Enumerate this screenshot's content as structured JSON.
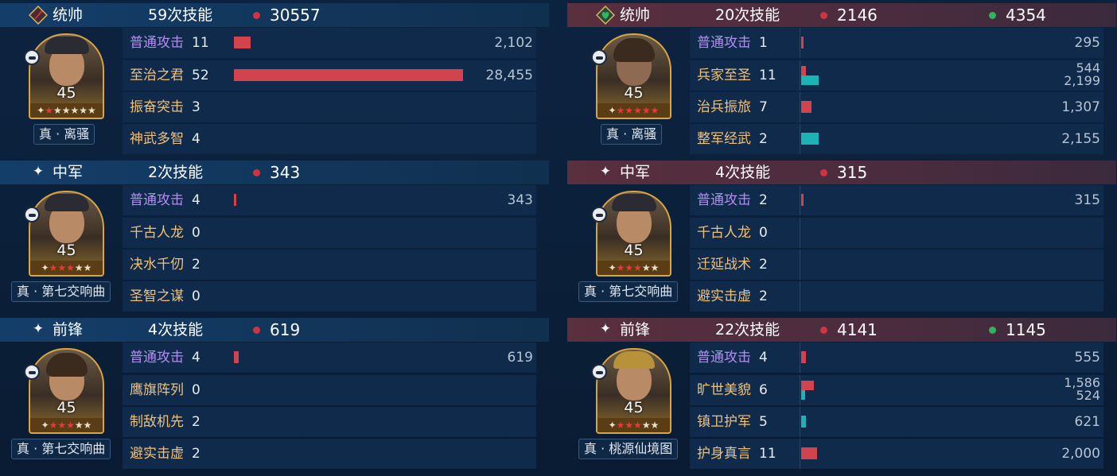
{
  "colors": {
    "damage_dot": "#d0343f",
    "heal_dot": "#2db560",
    "damage_bar": "#d2434e",
    "heal_bar": "#1bb3b3",
    "basic_attack_text": "#b58df2",
    "skill_text": "#f0c17a"
  },
  "left": {
    "generals": [
      {
        "role": "统帅",
        "role_icon": "red-diamond-sword-icon",
        "skill_count": "59次技能",
        "damage": "30557",
        "heal": "",
        "level": "45",
        "tactic": "真 · 离骚",
        "red_stars": 1,
        "total_stars": 6,
        "skills": [
          {
            "name": "普通攻击",
            "count": "11",
            "damage": 2102,
            "damage_text": "2,102",
            "heal": 0,
            "heal_text": "",
            "basic": true
          },
          {
            "name": "至治之君",
            "count": "52",
            "damage": 28455,
            "damage_text": "28,455",
            "heal": 0,
            "heal_text": "",
            "basic": false
          },
          {
            "name": "振奋突击",
            "count": "3",
            "damage": 0,
            "damage_text": "",
            "heal": 0,
            "heal_text": "",
            "basic": false
          },
          {
            "name": "神武多智",
            "count": "4",
            "damage": 0,
            "damage_text": "",
            "heal": 0,
            "heal_text": "",
            "basic": false
          }
        ]
      },
      {
        "role": "中军",
        "role_icon": "sparkle-icon",
        "skill_count": "2次技能",
        "damage": "343",
        "heal": "",
        "level": "45",
        "tactic": "真 · 第七交响曲",
        "red_stars": 3,
        "total_stars": 5,
        "skills": [
          {
            "name": "普通攻击",
            "count": "4",
            "damage": 343,
            "damage_text": "343",
            "heal": 0,
            "heal_text": "",
            "basic": true
          },
          {
            "name": "千古人龙",
            "count": "0",
            "damage": 0,
            "damage_text": "",
            "heal": 0,
            "heal_text": "",
            "basic": false
          },
          {
            "name": "决水千仞",
            "count": "2",
            "damage": 0,
            "damage_text": "",
            "heal": 0,
            "heal_text": "",
            "basic": false
          },
          {
            "name": "圣智之谋",
            "count": "0",
            "damage": 0,
            "damage_text": "",
            "heal": 0,
            "heal_text": "",
            "basic": false
          }
        ]
      },
      {
        "role": "前锋",
        "role_icon": "sparkle-icon",
        "skill_count": "4次技能",
        "damage": "619",
        "heal": "",
        "level": "45",
        "tactic": "真 · 第七交响曲",
        "red_stars": 3,
        "total_stars": 5,
        "skills": [
          {
            "name": "普通攻击",
            "count": "4",
            "damage": 619,
            "damage_text": "619",
            "heal": 0,
            "heal_text": "",
            "basic": true
          },
          {
            "name": "鹰旗阵列",
            "count": "0",
            "damage": 0,
            "damage_text": "",
            "heal": 0,
            "heal_text": "",
            "basic": false
          },
          {
            "name": "制敌机先",
            "count": "2",
            "damage": 0,
            "damage_text": "",
            "heal": 0,
            "heal_text": "",
            "basic": false
          },
          {
            "name": "避实击虚",
            "count": "2",
            "damage": 0,
            "damage_text": "",
            "heal": 0,
            "heal_text": "",
            "basic": false
          }
        ]
      }
    ]
  },
  "right": {
    "generals": [
      {
        "role": "统帅",
        "role_icon": "green-diamond-heart-icon",
        "skill_count": "20次技能",
        "damage": "2146",
        "heal": "4354",
        "level": "45",
        "tactic": "真 · 离骚",
        "red_stars": 5,
        "total_stars": 5,
        "skills": [
          {
            "name": "普通攻击",
            "count": "1",
            "damage": 295,
            "damage_text": "295",
            "heal": 0,
            "heal_text": "",
            "basic": true
          },
          {
            "name": "兵家至圣",
            "count": "11",
            "damage": 544,
            "damage_text": "544",
            "heal": 2199,
            "heal_text": "2,199",
            "basic": false
          },
          {
            "name": "治兵振旅",
            "count": "7",
            "damage": 1307,
            "damage_text": "1,307",
            "heal": 0,
            "heal_text": "",
            "basic": false
          },
          {
            "name": "整军经武",
            "count": "2",
            "damage": 0,
            "damage_text": "",
            "heal": 2155,
            "heal_text": "2,155",
            "basic": false
          }
        ]
      },
      {
        "role": "中军",
        "role_icon": "sparkle-icon",
        "skill_count": "4次技能",
        "damage": "315",
        "heal": "",
        "level": "45",
        "tactic": "真 · 第七交响曲",
        "red_stars": 3,
        "total_stars": 5,
        "skills": [
          {
            "name": "普通攻击",
            "count": "2",
            "damage": 315,
            "damage_text": "315",
            "heal": 0,
            "heal_text": "",
            "basic": true
          },
          {
            "name": "千古人龙",
            "count": "0",
            "damage": 0,
            "damage_text": "",
            "heal": 0,
            "heal_text": "",
            "basic": false
          },
          {
            "name": "迁延战术",
            "count": "2",
            "damage": 0,
            "damage_text": "",
            "heal": 0,
            "heal_text": "",
            "basic": false
          },
          {
            "name": "避实击虚",
            "count": "2",
            "damage": 0,
            "damage_text": "",
            "heal": 0,
            "heal_text": "",
            "basic": false
          }
        ]
      },
      {
        "role": "前锋",
        "role_icon": "sparkle-icon",
        "skill_count": "22次技能",
        "damage": "4141",
        "heal": "1145",
        "level": "45",
        "tactic": "真 · 桃源仙境图",
        "red_stars": 3,
        "total_stars": 5,
        "skills": [
          {
            "name": "普通攻击",
            "count": "4",
            "damage": 555,
            "damage_text": "555",
            "heal": 0,
            "heal_text": "",
            "basic": true
          },
          {
            "name": "旷世美貌",
            "count": "6",
            "damage": 1586,
            "damage_text": "1,586",
            "heal": 524,
            "heal_text": "524",
            "basic": false
          },
          {
            "name": "镇卫护军",
            "count": "5",
            "damage": 0,
            "damage_text": "",
            "heal": 621,
            "heal_text": "621",
            "basic": false
          },
          {
            "name": "护身真言",
            "count": "11",
            "damage": 2000,
            "damage_text": "2,000",
            "heal": 0,
            "heal_text": "",
            "basic": false
          }
        ]
      }
    ]
  }
}
